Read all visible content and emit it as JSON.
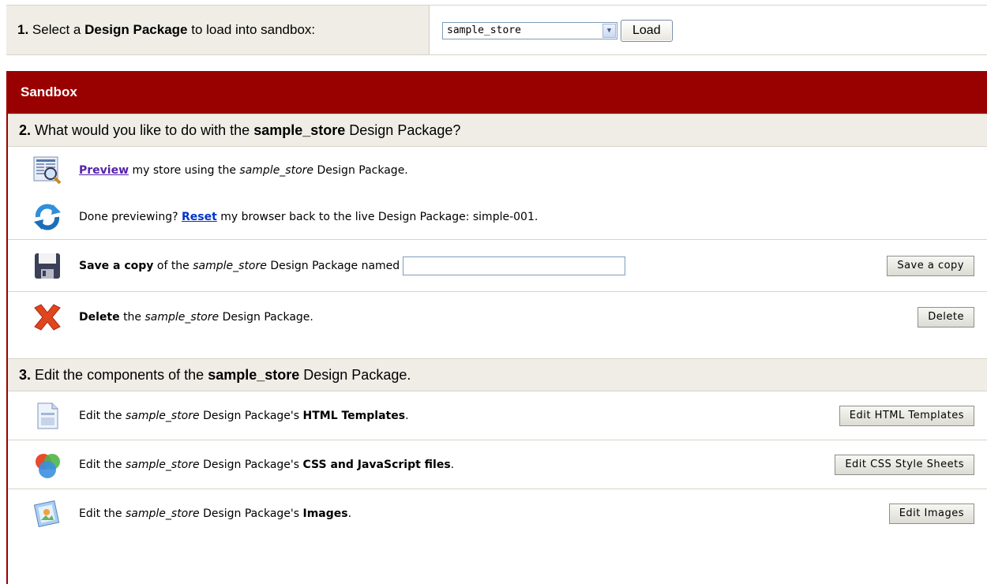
{
  "step1": {
    "number": "1.",
    "text_before": "Select a",
    "text_bold": "Design Package",
    "text_after": "to load into sandbox:",
    "selected_package": "sample_store",
    "load_label": "Load"
  },
  "sandbox": {
    "title": "Sandbox",
    "step2": {
      "number": "2.",
      "text_before": "What would you like to do with the",
      "package": "sample_store",
      "text_after": "Design Package?"
    },
    "preview": {
      "link": "Preview",
      "text_a": "my store using the",
      "package": "sample_store",
      "text_b": "Design Package."
    },
    "reset": {
      "text_a": "Done previewing?",
      "link": "Reset",
      "text_b": "my browser back to the live Design Package: simple-001."
    },
    "save": {
      "bold": "Save a copy",
      "text_a": "of the",
      "package": "sample_store",
      "text_b": "Design Package named",
      "input_value": "",
      "button": "Save a copy"
    },
    "delete": {
      "bold": "Delete",
      "text_a": "the",
      "package": "sample_store",
      "text_b": "Design Package.",
      "button": "Delete"
    },
    "step3": {
      "number": "3.",
      "text_before": "Edit the components of the",
      "package": "sample_store",
      "text_after": "Design Package."
    },
    "edit_html": {
      "text_a": "Edit the",
      "package": "sample_store",
      "text_b": "Design Package's",
      "bold": "HTML Templates",
      "end": ".",
      "button": "Edit HTML Templates"
    },
    "edit_css": {
      "text_a": "Edit the",
      "package": "sample_store",
      "text_b": "Design Package's",
      "bold": "CSS and JavaScript files",
      "end": ".",
      "button": "Edit CSS Style Sheets"
    },
    "edit_images": {
      "text_a": "Edit the",
      "package": "sample_store",
      "text_b": "Design Package's",
      "bold": "Images",
      "end": ".",
      "button": "Edit Images"
    }
  },
  "colors": {
    "header_red": "#990000",
    "section_bg": "#efede6",
    "visited_link": "#5522aa",
    "link_blue": "#0033cc"
  },
  "icons": [
    "preview-icon",
    "reset-icon",
    "save-icon",
    "delete-icon",
    "html-template-icon",
    "css-icon",
    "images-icon",
    "dropdown-arrow-icon"
  ]
}
